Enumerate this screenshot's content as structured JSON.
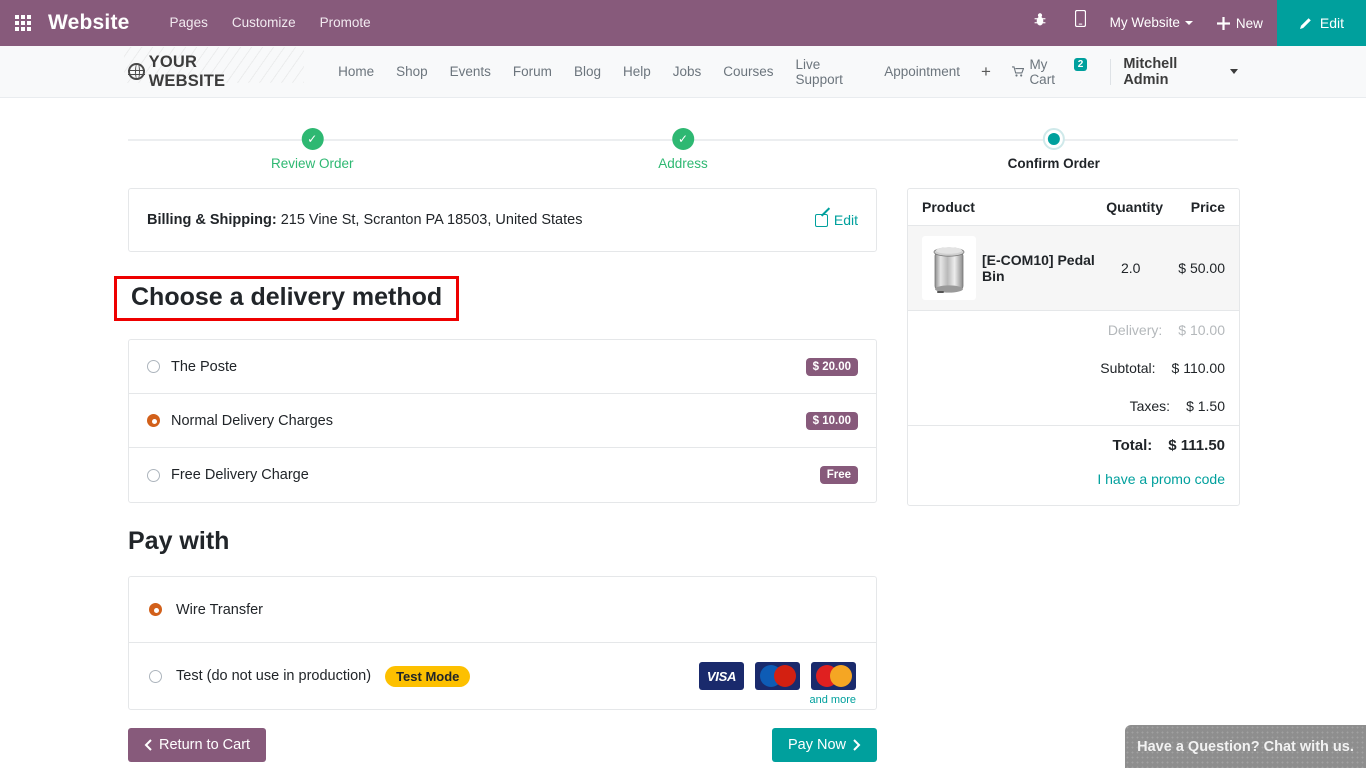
{
  "backend": {
    "app_name": "Website",
    "apps_icon": "apps-grid-icon",
    "menu": [
      "Pages",
      "Customize",
      "Promote"
    ],
    "bug_icon": "bug-icon",
    "mobile_icon": "mobile-preview-icon",
    "site_selector": "My Website",
    "new_label": "New",
    "new_icon": "plus-icon",
    "edit_label": "Edit",
    "edit_icon": "pencil-icon",
    "bar_color": "#875a7b",
    "edit_color": "#00a09d"
  },
  "site_header": {
    "brand": "YOUR WEBSITE",
    "brand_icon": "globe-icon",
    "nav": [
      "Home",
      "Shop",
      "Events",
      "Forum",
      "Blog",
      "Help",
      "Jobs",
      "Courses",
      "Live Support",
      "Appointment"
    ],
    "plus_label": "+",
    "cart_label": "My Cart",
    "cart_icon": "shopping-cart-icon",
    "cart_count": "2",
    "user": "Mitchell Admin"
  },
  "wizard": {
    "steps": [
      {
        "label": "Review Order",
        "state": "done"
      },
      {
        "label": "Address",
        "state": "done"
      },
      {
        "label": "Confirm Order",
        "state": "current"
      }
    ]
  },
  "address": {
    "label": "Billing & Shipping:",
    "value": "215 Vine St, Scranton PA 18503, United States",
    "edit_label": "Edit",
    "edit_icon": "edit-pencil-icon"
  },
  "delivery": {
    "title": "Choose a delivery method",
    "highlight_color": "#ee0000",
    "options": [
      {
        "label": "The Poste",
        "price": "$ 20.00",
        "selected": false
      },
      {
        "label": "Normal Delivery Charges",
        "price": "$ 10.00",
        "selected": true
      },
      {
        "label": "Free Delivery Charge",
        "price": "Free",
        "selected": false
      }
    ]
  },
  "payment": {
    "title": "Pay with",
    "options": [
      {
        "label": "Wire Transfer",
        "selected": true,
        "badge": null
      },
      {
        "label": "Test (do not use in production)",
        "selected": false,
        "badge": "Test Mode"
      }
    ],
    "card_logos": [
      "VISA",
      "Maestro",
      "MasterCard"
    ],
    "and_more": "and more"
  },
  "buttons": {
    "return_label": "Return to Cart",
    "return_icon": "chevron-left-icon",
    "pay_label": "Pay Now",
    "pay_icon": "chevron-right-icon"
  },
  "summary": {
    "headers": {
      "product": "Product",
      "quantity": "Quantity",
      "price": "Price"
    },
    "item": {
      "name": "[E-COM10] Pedal Bin",
      "qty": "2.0",
      "price": "$ 50.00",
      "thumb_icon": "pedal-bin-image"
    },
    "lines": [
      {
        "label": "Delivery:",
        "value": "$ 10.00",
        "muted": true
      },
      {
        "label": "Subtotal:",
        "value": "$ 110.00",
        "muted": false
      },
      {
        "label": "Taxes:",
        "value": "$ 1.50",
        "muted": false
      }
    ],
    "total": {
      "label": "Total:",
      "value": "$ 111.50"
    },
    "promo_label": "I have a promo code"
  },
  "chat": {
    "label": "Have a Question? Chat with us."
  }
}
